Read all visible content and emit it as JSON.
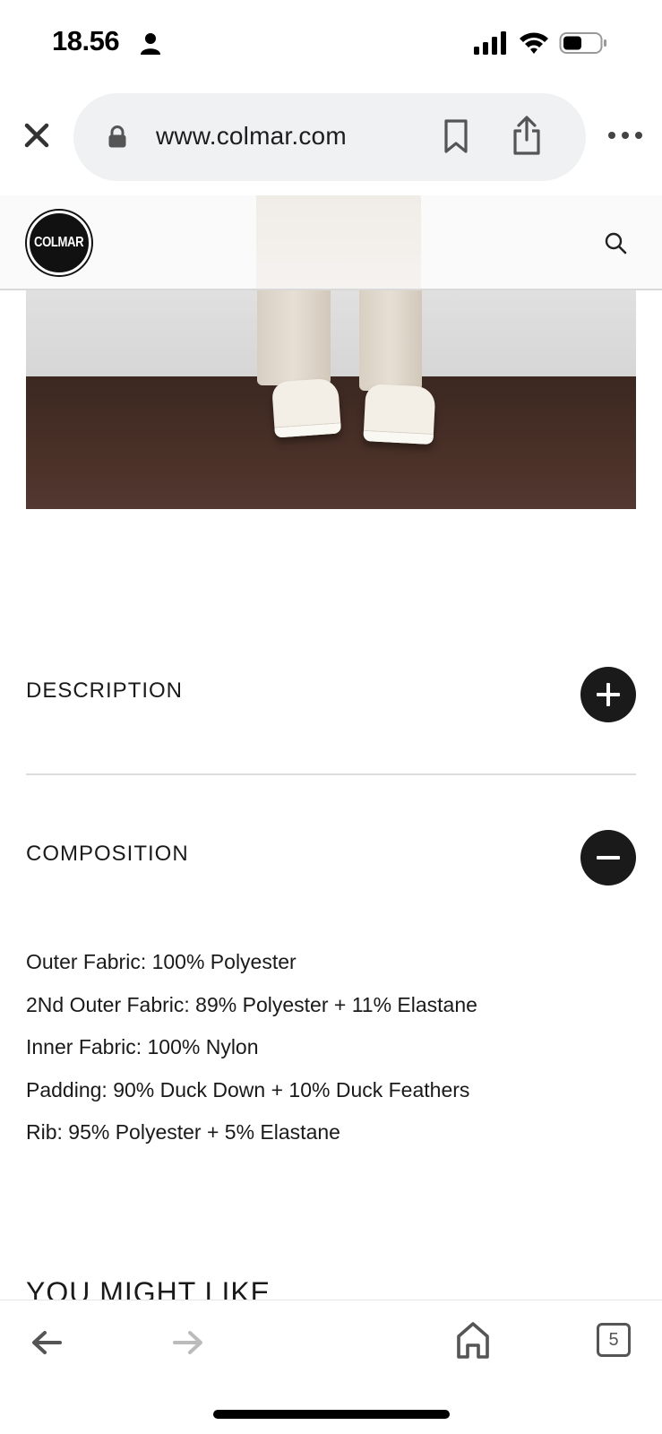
{
  "status_bar": {
    "time": "18.56",
    "icons": [
      "person-icon",
      "cellular-signal-icon",
      "wifi-icon",
      "battery-icon"
    ]
  },
  "browser": {
    "url": "www.colmar.com",
    "icons": [
      "close-icon",
      "lock-icon",
      "bookmark-icon",
      "share-icon",
      "more-icon"
    ]
  },
  "site_header": {
    "logo_text": "COLMAR",
    "icons": [
      "search-icon"
    ]
  },
  "accordion": {
    "description_title": "DESCRIPTION",
    "composition_title": "COMPOSITION",
    "description_expanded": false,
    "composition_expanded": true
  },
  "composition": {
    "items": [
      "Outer Fabric: 100% Polyester",
      "2Nd Outer Fabric: 89% Polyester + 11% Elastane",
      "Inner Fabric: 100% Nylon",
      "Padding: 90% Duck Down + 10% Duck Feathers",
      "Rib: 95% Polyester + 5% Elastane"
    ]
  },
  "recommendations": {
    "title": "YOU MIGHT LIKE"
  },
  "toolbar": {
    "tab_count": "5",
    "icons": [
      "back-arrow-icon",
      "forward-arrow-icon",
      "home-icon",
      "tabs-icon"
    ]
  },
  "colors": {
    "text": "#1a1a1a",
    "button_bg": "#1a1a1a",
    "url_bar_bg": "#f0f1f3",
    "floor": "#4a3128"
  }
}
